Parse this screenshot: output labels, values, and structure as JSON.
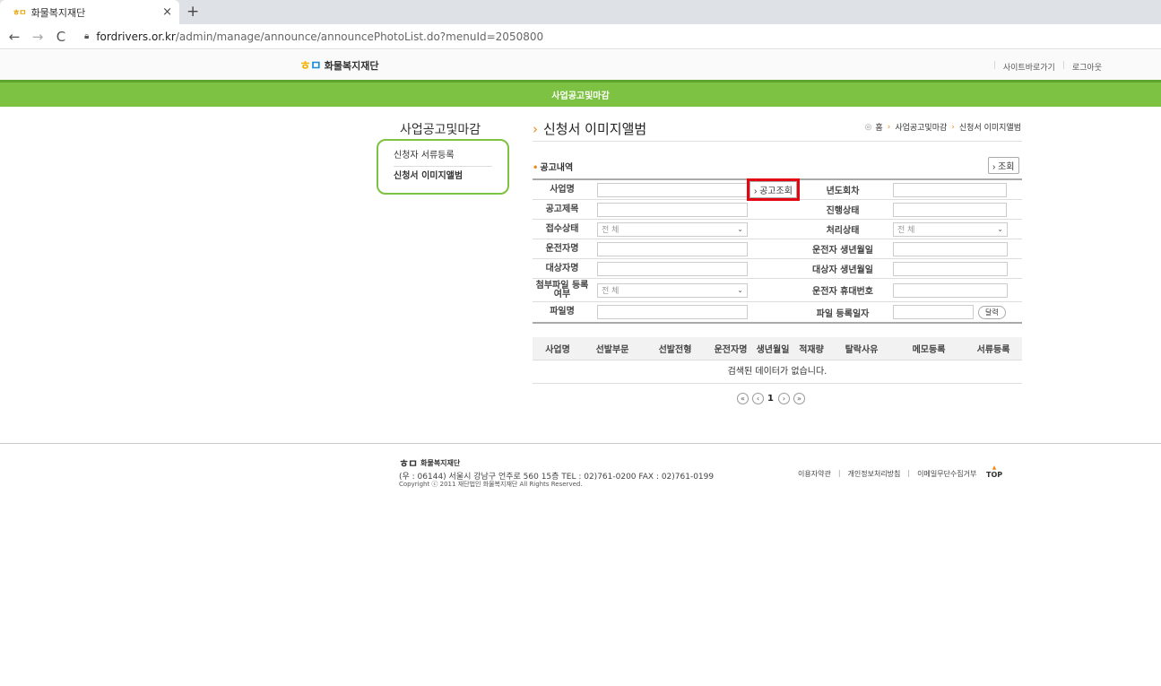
{
  "browser": {
    "tab_title": "화물복지재단",
    "favicon_text": "ㅎㅁ",
    "close_glyph": "×",
    "newtab_glyph": "+",
    "url_host": "fordrivers.or.kr",
    "url_path": "/admin/manage/announce/announcePhotoList.do?menuId=2050800",
    "back_glyph": "←",
    "forward_glyph": "→",
    "reload_glyph": "C"
  },
  "header": {
    "logo_text": "화물복지재단",
    "util_links": [
      "사이트바로가기",
      "로그아웃"
    ],
    "green_title": "사업공고및마감"
  },
  "sidebar": {
    "title": "사업공고및마감",
    "items": [
      "신청자 서류등록",
      "신청서 이미지앨범"
    ]
  },
  "main": {
    "page_title": "신청서 이미지앨범",
    "breadcrumb": [
      "홈",
      "사업공고및마감",
      "신청서 이미지앨범"
    ],
    "section_title": "공고내역",
    "inquiry_button": "조회",
    "form": {
      "labels": {
        "business_name": "사업명",
        "year_round": "년도회차",
        "notice_title": "공고제목",
        "progress_status": "진행상태",
        "receipt_status": "접수상태",
        "process_status": "처리상태",
        "driver_name": "운전자명",
        "driver_birth": "운전자 생년월일",
        "target_name": "대상자명",
        "target_birth": "대상자 생년월일",
        "attach_yn": "첨부파일 등록여부",
        "driver_phone": "운전자 휴대번호",
        "file_name": "파일명",
        "file_reg_date": "파일 등록일자"
      },
      "search_notice_button": "공고조회",
      "select_all": "전 체",
      "calendar_button": "달력"
    },
    "results": {
      "columns": [
        "사업명",
        "선발부문",
        "선발전형",
        "운전자명",
        "생년월일",
        "적재량",
        "탈락사유",
        "메모등록",
        "서류등록"
      ],
      "empty_message": "검색된 데이터가 없습니다.",
      "pager": {
        "first": "«",
        "prev": "‹",
        "current": "1",
        "next": "›",
        "last": "»"
      }
    }
  },
  "footer": {
    "logo_text": "화물복지재단",
    "address": "(우 : 06144) 서울시 강남구 언주로 560 15층   TEL : 02)761-0200   FAX : 02)761-0199",
    "copyright": "Copyright ⓒ 2011 재단법인 화물복지재단  All Rights Reserved.",
    "links": [
      "이용자약관",
      "개인정보처리방침",
      "이메일무단수집거부"
    ],
    "top": "TOP"
  }
}
